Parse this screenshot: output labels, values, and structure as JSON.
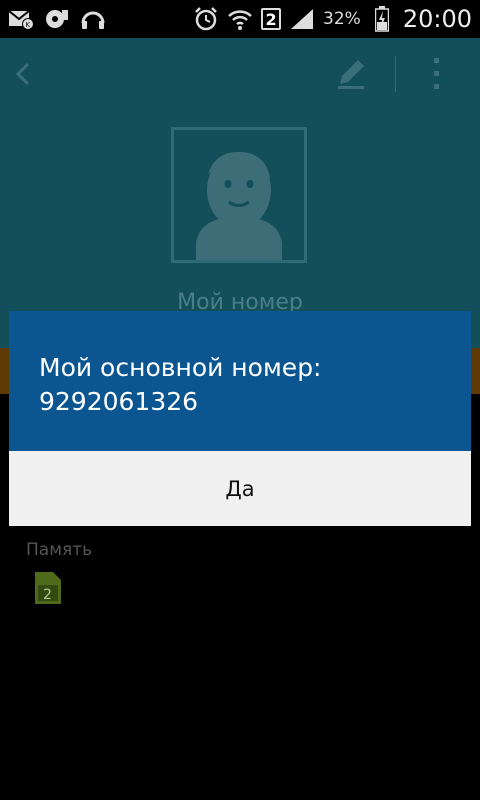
{
  "status_bar": {
    "icons": [
      "mail-icon",
      "vinyl-icon",
      "headphones-icon",
      "alarm-icon",
      "wifi-icon",
      "sim2-icon",
      "signal-icon",
      "battery-icon"
    ],
    "sim_number": "2",
    "battery": "32%",
    "time": "20:00"
  },
  "header": {
    "contact_name": "Мой номер"
  },
  "dialog": {
    "message_line1": "Мой основной номер:",
    "message_line2": "9292061326",
    "button": "Да"
  },
  "content": {
    "section_label": "Память",
    "sim_badge": "2"
  },
  "colors": {
    "header_bg": "#134e5b",
    "dialog_bg": "#0b5591",
    "button_bg": "#f0f0f0"
  }
}
